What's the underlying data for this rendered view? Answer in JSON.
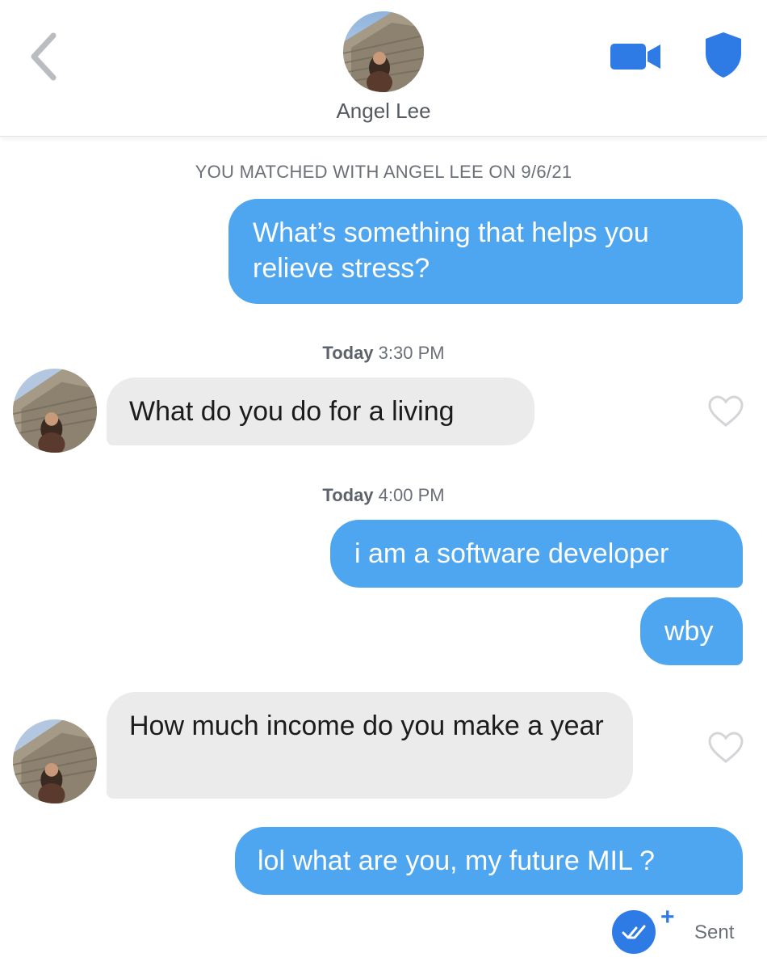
{
  "header": {
    "name": "Angel Lee"
  },
  "match_notice": "YOU MATCHED WITH ANGEL LEE ON 9/6/21",
  "messages": [
    {
      "text": "What’s something that helps you relieve stress?"
    },
    {
      "text": "What do you do for a living"
    },
    {
      "text": "i am a software developer"
    },
    {
      "text": "wby"
    },
    {
      "text": "How much income do you make a year"
    },
    {
      "text": "lol what are you, my future MIL ?"
    }
  ],
  "timestamps": [
    {
      "day": "Today",
      "time": "3:30 PM"
    },
    {
      "day": "Today",
      "time": "4:00 PM"
    }
  ],
  "status": {
    "plus": "+",
    "sent": "Sent"
  },
  "colors": {
    "accent": "#2f7be6",
    "outgoing_bubble": "#4ea6f0",
    "incoming_bubble": "#ebebeb"
  },
  "icons": [
    "chevron-left-icon",
    "video-camera-icon",
    "shield-icon",
    "heart-icon",
    "double-check-icon"
  ]
}
